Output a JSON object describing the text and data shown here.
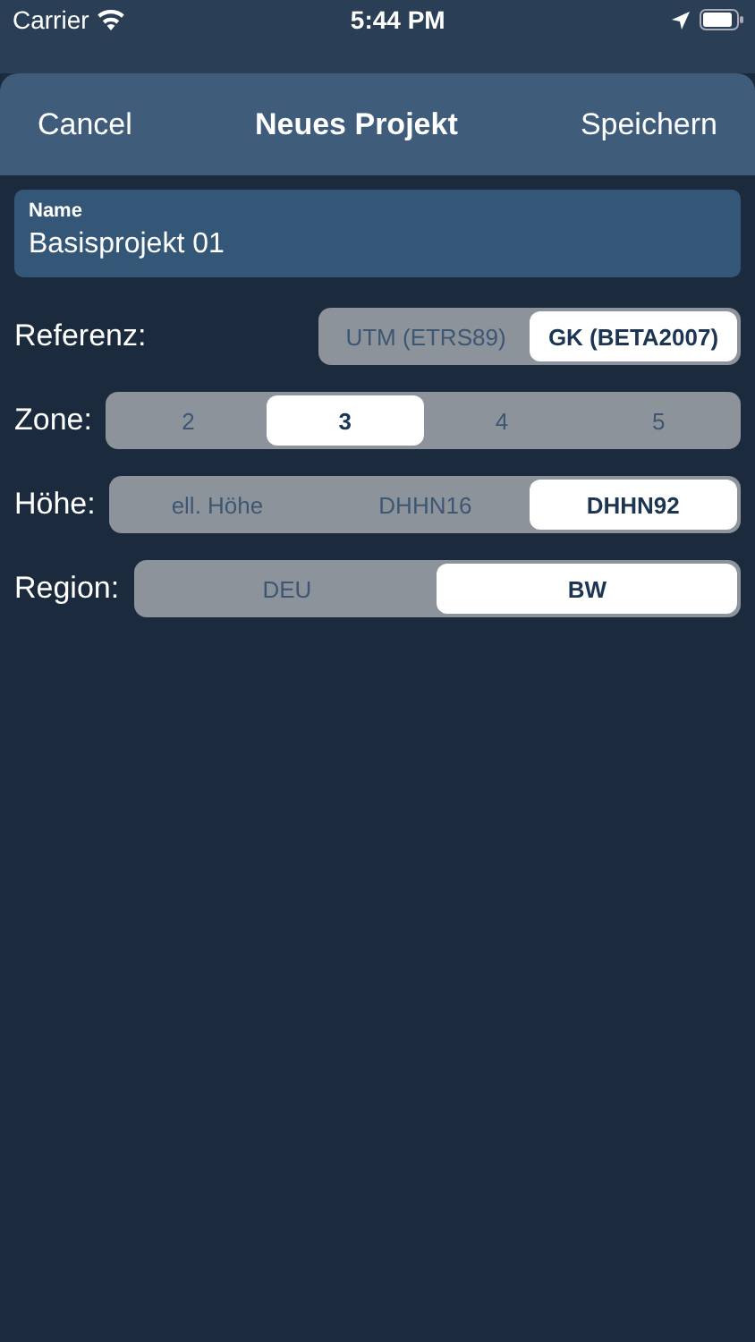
{
  "status_bar": {
    "carrier": "Carrier",
    "time": "5:44 PM"
  },
  "sheet": {
    "cancel": "Cancel",
    "title": "Neues Projekt",
    "save": "Speichern"
  },
  "name_field": {
    "label": "Name",
    "value": "Basisprojekt 01"
  },
  "settings": [
    {
      "label": "Referenz:",
      "kind": "right",
      "options": [
        {
          "label": "UTM (ETRS89)",
          "selected": false
        },
        {
          "label": "GK (BETA2007)",
          "selected": true
        }
      ]
    },
    {
      "label": "Zone:",
      "kind": "full",
      "options": [
        {
          "label": "2",
          "selected": false
        },
        {
          "label": "3",
          "selected": true
        },
        {
          "label": "4",
          "selected": false
        },
        {
          "label": "5",
          "selected": false
        }
      ]
    },
    {
      "label": "Höhe:",
      "kind": "full",
      "options": [
        {
          "label": "ell. Höhe",
          "selected": false
        },
        {
          "label": "DHHN16",
          "selected": false
        },
        {
          "label": "DHHN92",
          "selected": true
        }
      ]
    },
    {
      "label": "Region:",
      "kind": "full",
      "options": [
        {
          "label": "DEU",
          "selected": false
        },
        {
          "label": "BW",
          "selected": true
        }
      ]
    }
  ]
}
